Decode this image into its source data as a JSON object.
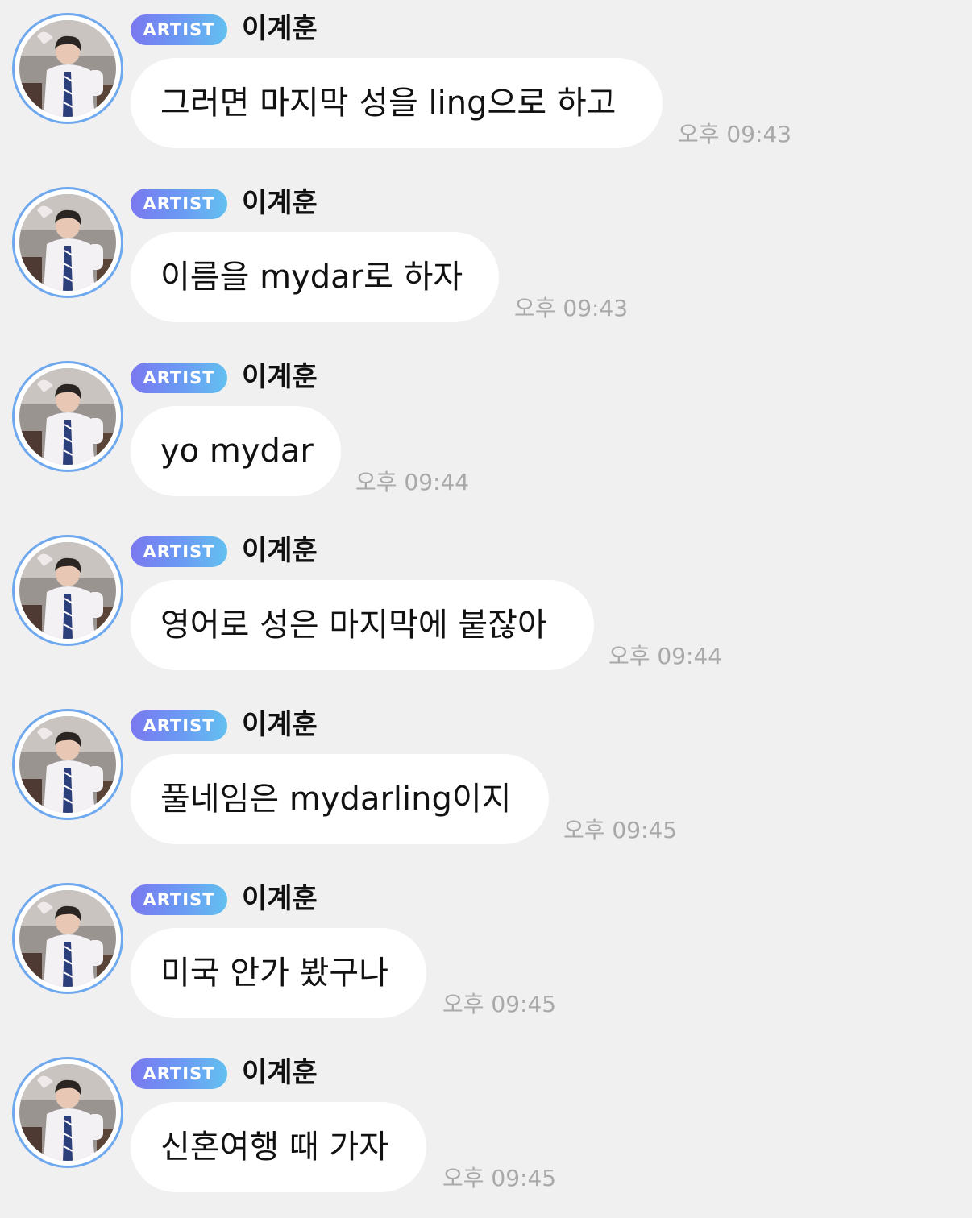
{
  "messages": [
    {
      "badge": "ARTIST",
      "sender": "이계훈",
      "text": "그러면 마지막 성을 ling으로 하고",
      "time": "오후 09:43"
    },
    {
      "badge": "ARTIST",
      "sender": "이계훈",
      "text": "이름을 mydar로 하자",
      "time": "오후 09:43"
    },
    {
      "badge": "ARTIST",
      "sender": "이계훈",
      "text": "yo mydar",
      "time": "오후 09:44"
    },
    {
      "badge": "ARTIST",
      "sender": "이계훈",
      "text": "영어로 성은 마지막에 붙잖아",
      "time": "오후 09:44"
    },
    {
      "badge": "ARTIST",
      "sender": "이계훈",
      "text": "풀네임은 mydarling이지",
      "time": "오후 09:45"
    },
    {
      "badge": "ARTIST",
      "sender": "이계훈",
      "text": "미국 안가 봤구나",
      "time": "오후 09:45"
    },
    {
      "badge": "ARTIST",
      "sender": "이계훈",
      "text": "신혼여행 때 가자",
      "time": "오후 09:45"
    }
  ]
}
